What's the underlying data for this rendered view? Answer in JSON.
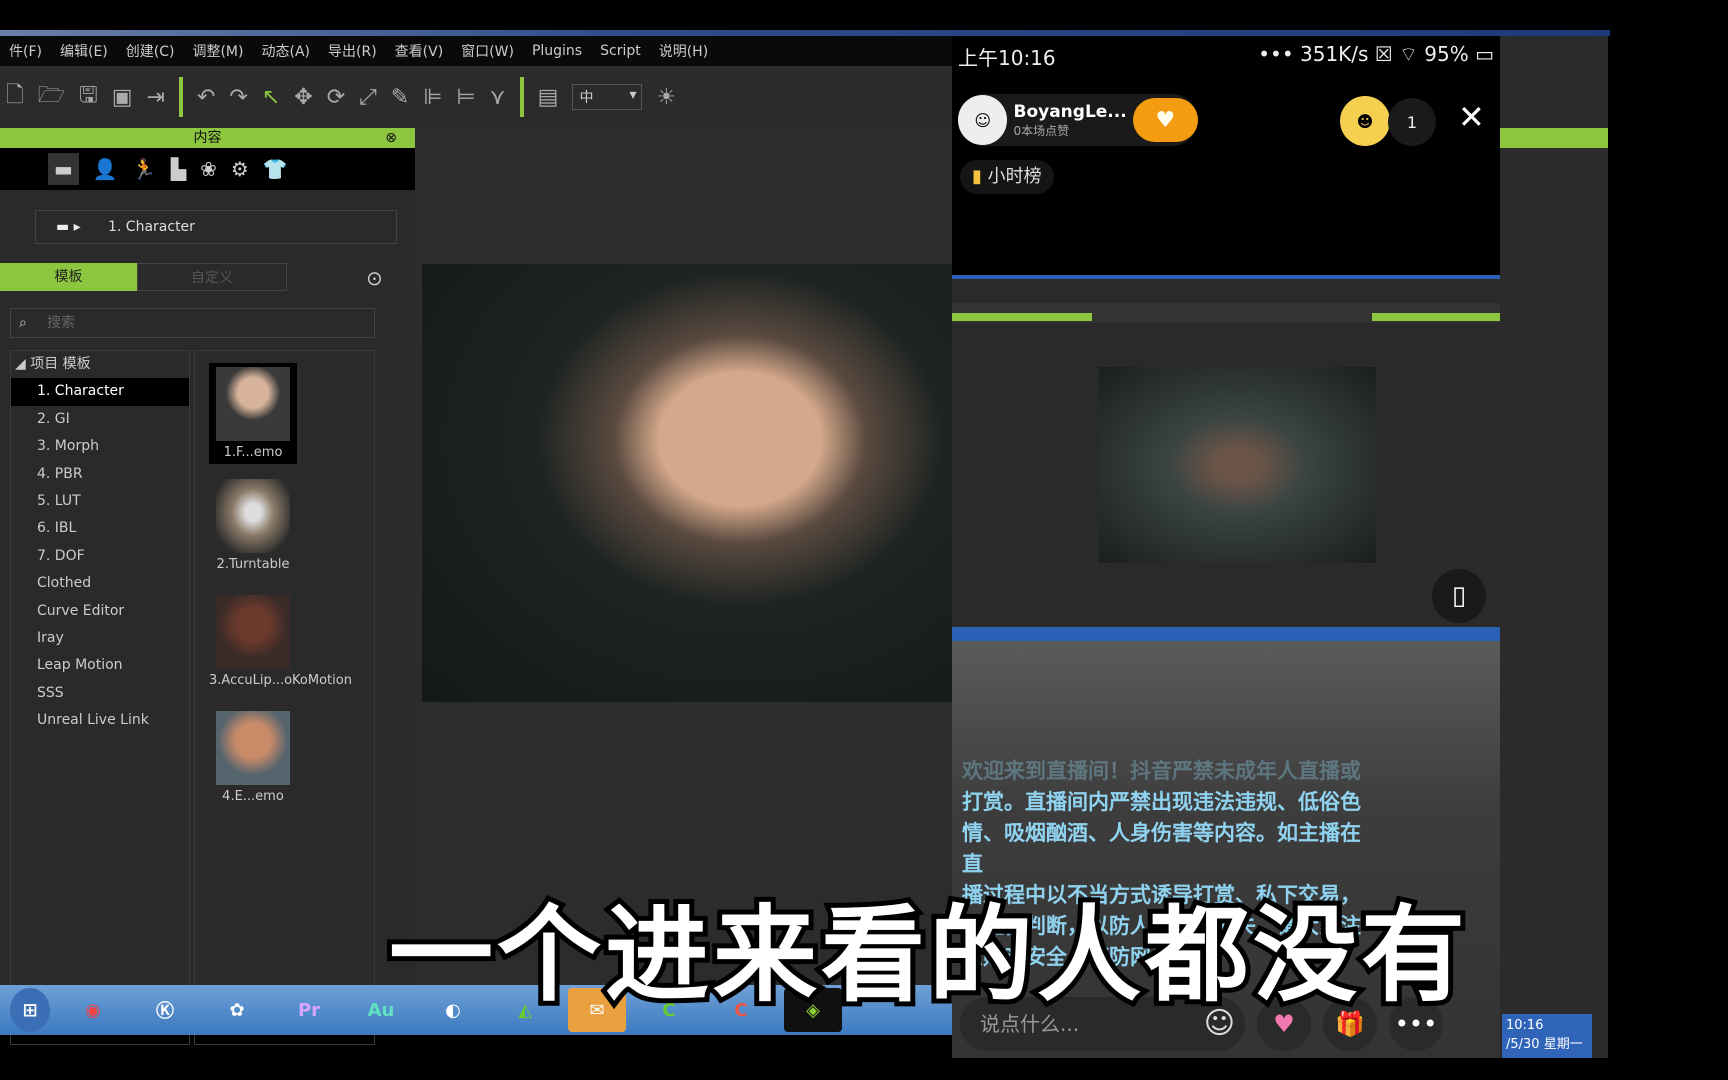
{
  "menu": [
    "件(F)",
    "编辑(E)",
    "创建(C)",
    "调整(M)",
    "动态(A)",
    "导出(R)",
    "查看(V)",
    "窗口(W)",
    "Plugins",
    "Script",
    "说明(H)"
  ],
  "toolbar": {
    "dropdown_value": "中"
  },
  "content_panel": {
    "title": "内容",
    "breadcrumb": "1. Character",
    "tabs": [
      "模板",
      "自定义"
    ],
    "search_placeholder": "搜索",
    "tree_root": "项目 模板",
    "tree": [
      "1. Character",
      "2. GI",
      "3. Morph",
      "4. PBR",
      "5. LUT",
      "6. IBL",
      "7. DOF",
      "Clothed",
      "Curve Editor",
      "Iray",
      "Leap Motion",
      "SSS",
      "Unreal Live Link"
    ],
    "thumbnails": [
      "1.F...emo",
      "2.Turntable",
      "3.AccuLip...oKoMotion",
      "4.E...emo"
    ]
  },
  "taskbar": {
    "apps": [
      "start",
      "chrome",
      "kugou",
      "app",
      "Pr",
      "Au",
      "obs",
      "app",
      "wechat",
      "C",
      "C",
      "iclone"
    ],
    "time": "10:16",
    "date": "/5/30 星期一"
  },
  "phone": {
    "time": "上午10:16",
    "network": "351K/s",
    "battery": "95%",
    "host_name": "BoyangLe...",
    "host_sub": "0本场点赞",
    "viewer_count": "1",
    "rank_label": "小时榜",
    "rules": [
      "欢迎来到直播间！抖音严禁未成年人直播或",
      "打赏。直播间内严禁出现违法违规、低俗色",
      "情、吸烟酗酒、人身伤害等内容。如主播在直",
      "播过程中以不当方式诱导打赏、私下交易，",
      "请谨慎判断，以防人身财产损失。请大家注",
      "意财产安全，谨防网络诈骗。"
    ],
    "comment_placeholder": "说点什么..."
  },
  "subtitle": "一个进来看的人都没有",
  "colors": {
    "accent": "#8cc63f",
    "follow": "#f39c12",
    "rules_text": "#8fd3f0"
  }
}
